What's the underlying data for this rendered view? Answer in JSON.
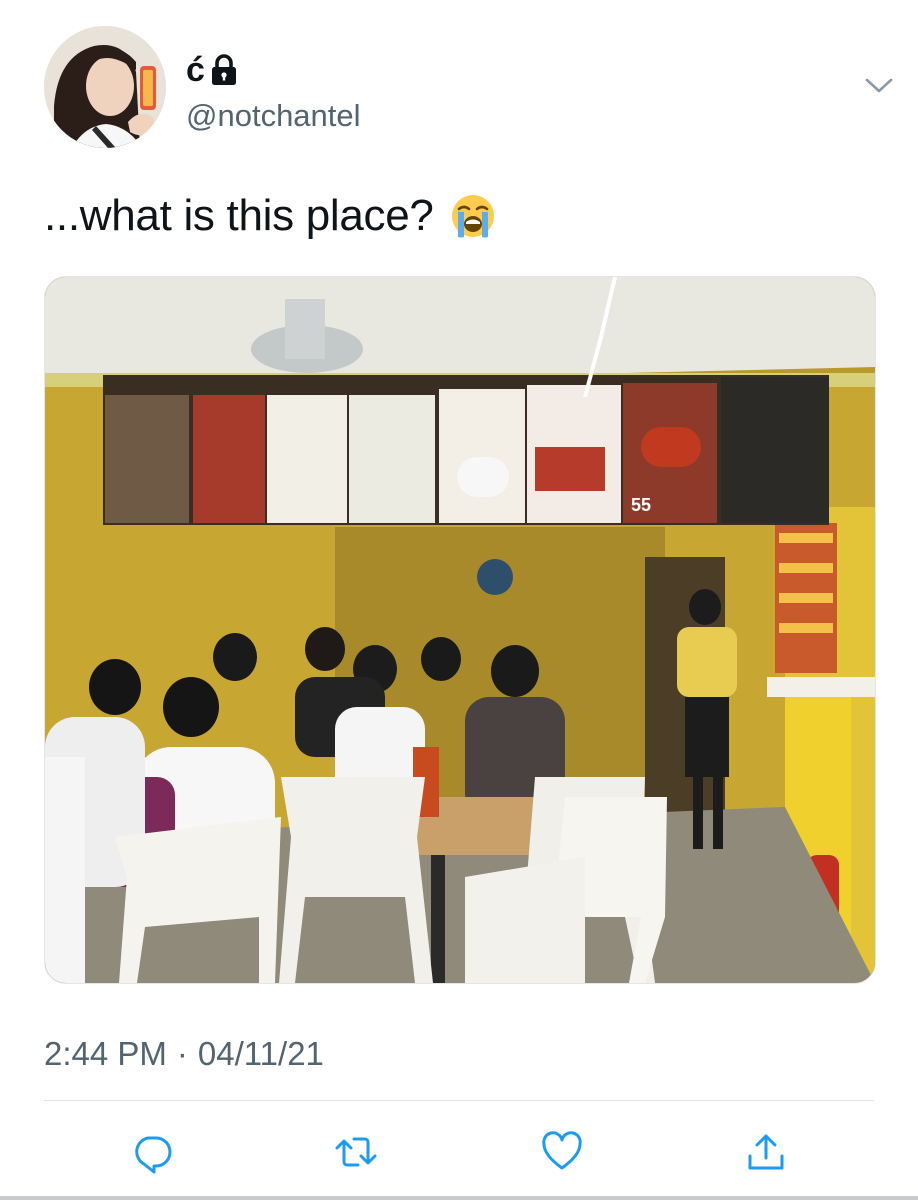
{
  "user": {
    "display_name": "ć",
    "handle": "@notchantel",
    "protected": true
  },
  "tweet": {
    "text": "...what is this place?",
    "emoji": "loudly-crying-face",
    "media_alt": "Photo of a small eatery with students seated on white plastic chairs and a menu board above the counter",
    "menu_price": "55",
    "time": "2:44 PM",
    "separator": "·",
    "date": "04/11/21"
  },
  "icons": {
    "reply": "reply-icon",
    "retweet": "retweet-icon",
    "like": "heart-icon",
    "share": "share-icon",
    "more": "chevron-down-icon",
    "lock": "lock-icon"
  },
  "colors": {
    "text": "#0f1419",
    "secondary": "#536471",
    "icon": "#1d9bf0",
    "divider": "#e3e6e9"
  }
}
